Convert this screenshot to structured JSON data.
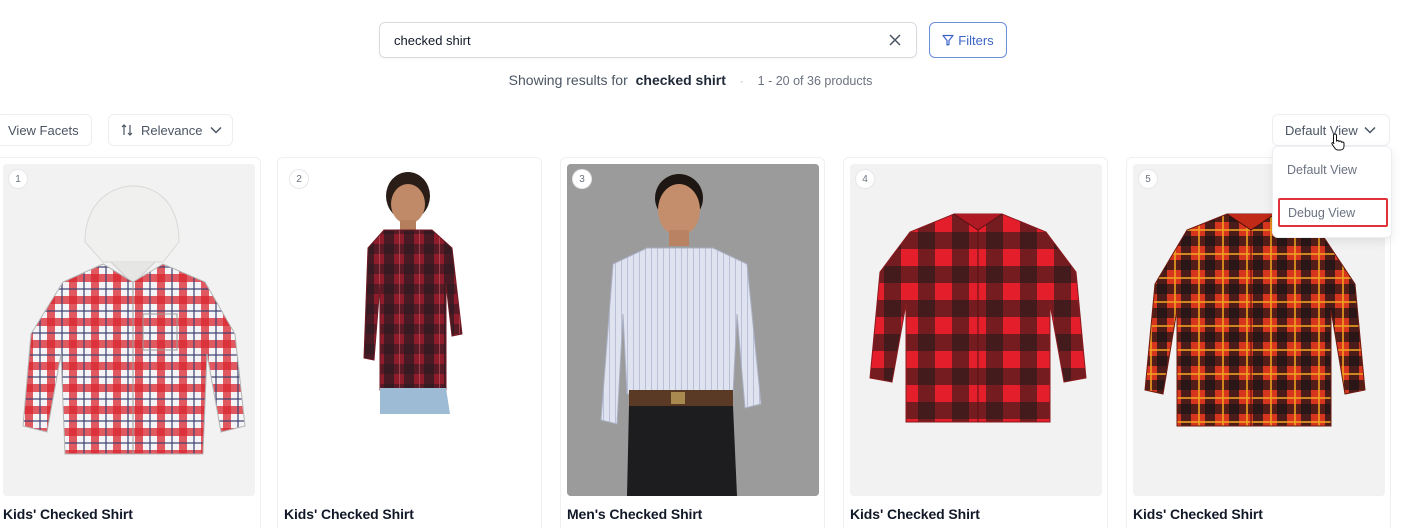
{
  "search": {
    "value": "checked shirt",
    "filters_label": "Filters"
  },
  "results": {
    "prefix": "Showing results for",
    "query": "checked shirt",
    "separator": "·",
    "count": "1 - 20 of 36 products"
  },
  "toolbar": {
    "view_facets": "View Facets",
    "sort_label": "Relevance",
    "view_label": "Default View"
  },
  "view_menu": {
    "items": [
      "Default View",
      "Debug View"
    ],
    "highlighted": "Debug View"
  },
  "products": [
    {
      "rank": "1",
      "title": "Kids' Checked Shirt"
    },
    {
      "rank": "2",
      "title": "Kids' Checked Shirt"
    },
    {
      "rank": "3",
      "title": "Men's Checked Shirt"
    },
    {
      "rank": "4",
      "title": "Kids' Checked Shirt"
    },
    {
      "rank": "5",
      "title": "Kids' Checked Shirt"
    }
  ],
  "colors": {
    "accent": "#3c64c8",
    "highlight_border": "#e0323a",
    "plaid_red": "#d9252f",
    "plaid_dark": "#2a1416"
  }
}
